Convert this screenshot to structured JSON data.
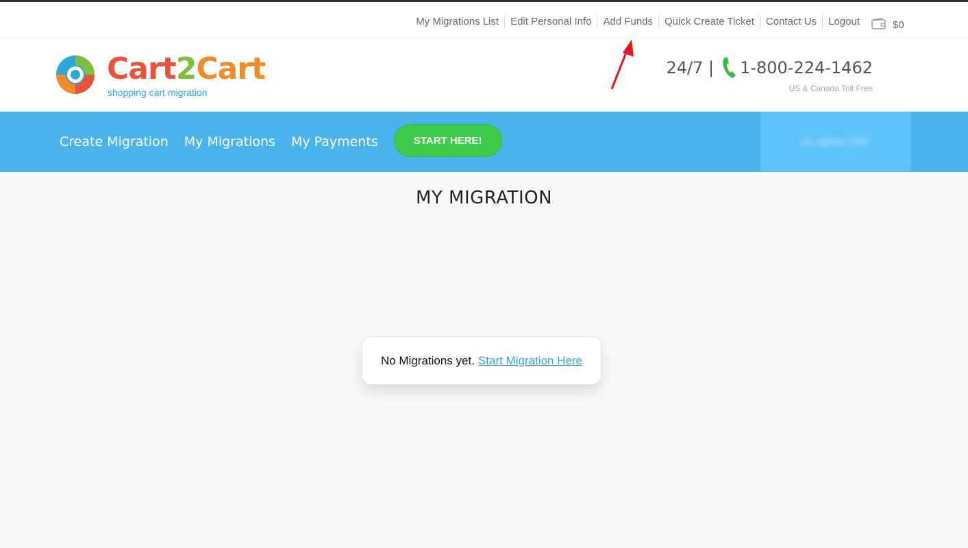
{
  "top_links": [
    {
      "label": "My Migrations List"
    },
    {
      "label": "Edit Personal Info"
    },
    {
      "label": "Add Funds"
    },
    {
      "label": "Quick Create Ticket"
    },
    {
      "label": "Contact Us"
    },
    {
      "label": "Logout"
    }
  ],
  "wallet": {
    "icon": "wallet-icon",
    "amount": "$0"
  },
  "logo": {
    "part1": "Cart",
    "part2": "2",
    "part3": "Cart",
    "tagline": "shopping cart migration"
  },
  "phone": {
    "availability": "24/7 |",
    "number": "1-800-224-1462",
    "note": "US & Canada Toll Free",
    "icon": "phone-icon"
  },
  "nav": {
    "items": [
      {
        "label": "Create Migration"
      },
      {
        "label": "My Migrations"
      },
      {
        "label": "My Payments"
      }
    ],
    "start_button": "START HERE!",
    "account_label": "Hi, admin CDE"
  },
  "colors": {
    "nav_bg": "#4ab3ec",
    "start_button": "#3dcc4a",
    "link": "#3aa3dd",
    "annotation_arrow": "#e8141c"
  },
  "main": {
    "title": "MY MIGRATION",
    "empty_text": "No Migrations yet.",
    "empty_link": "Start Migration Here"
  }
}
